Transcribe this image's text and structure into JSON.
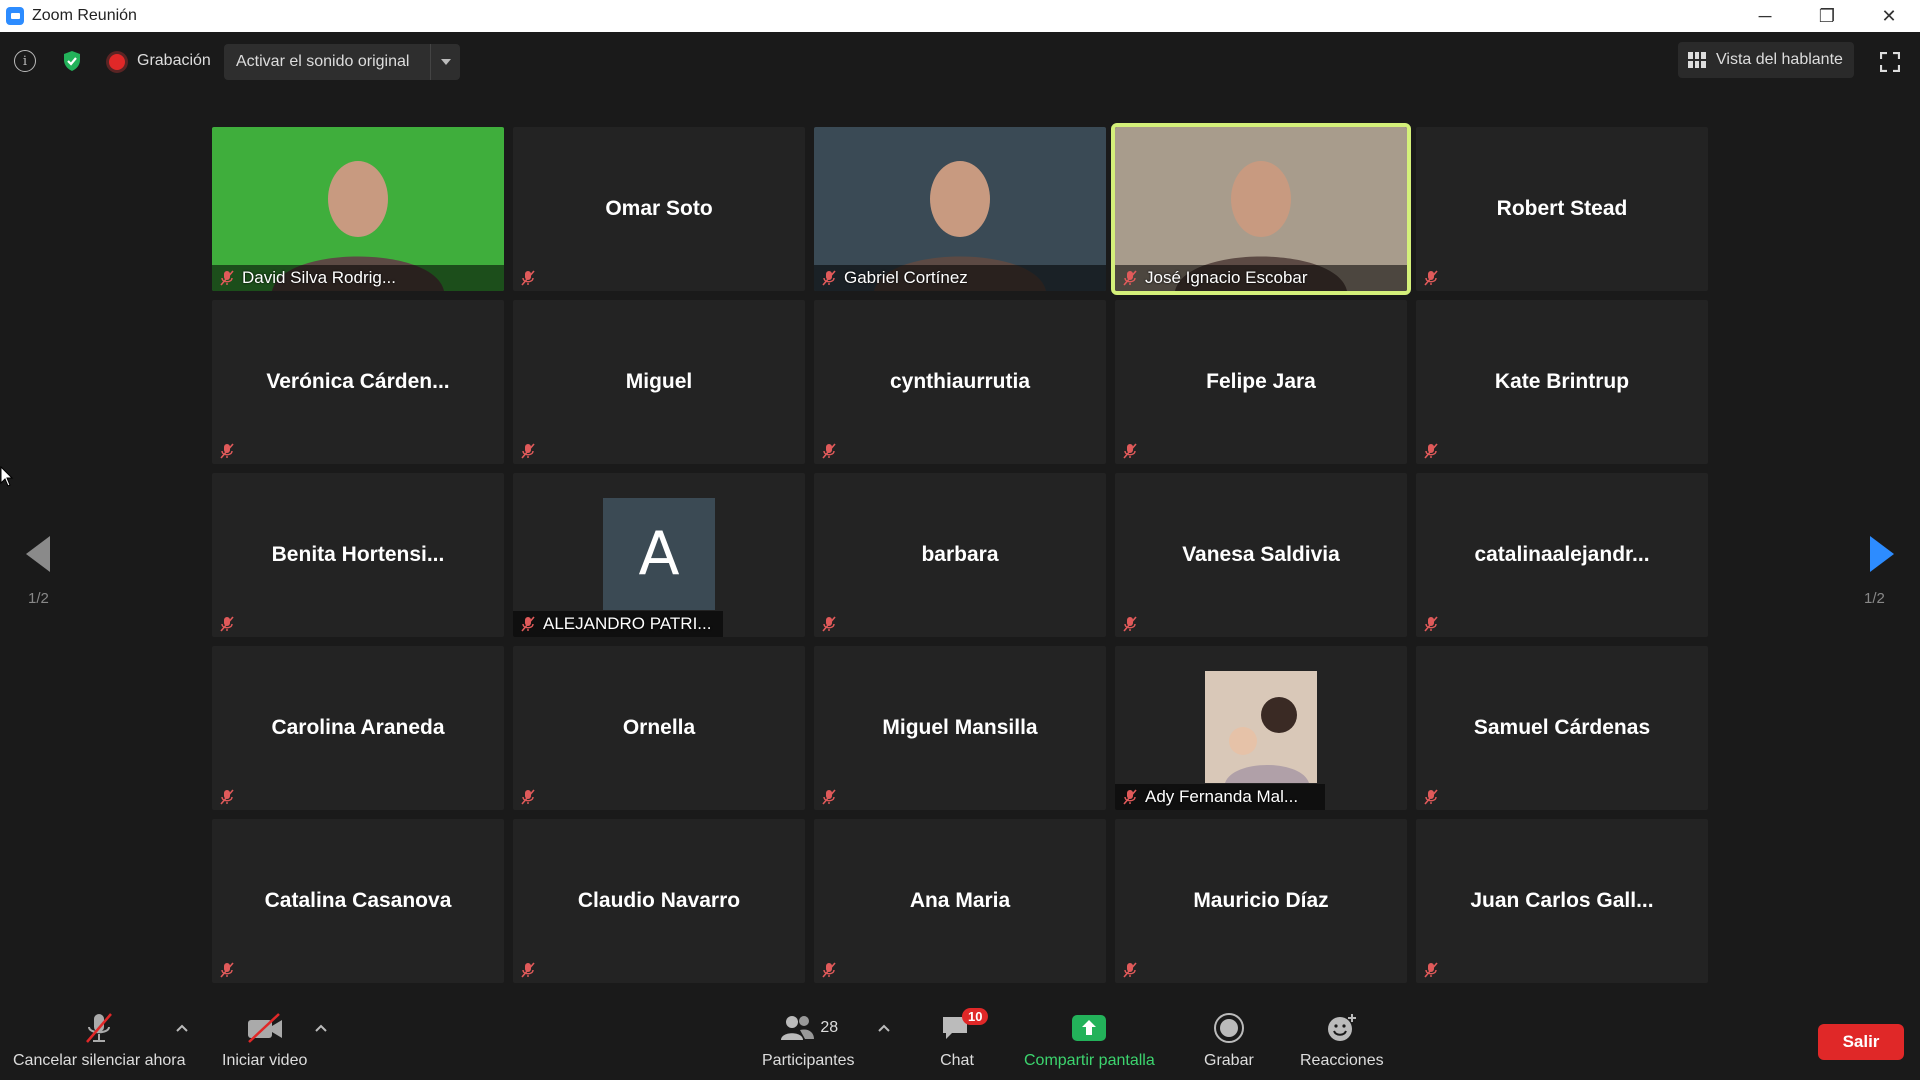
{
  "window": {
    "title": "Zoom Reunión",
    "controls": {
      "minimize": "─",
      "restore": "❐",
      "close": "✕"
    }
  },
  "topbar": {
    "recording_label": "Grabación",
    "original_sound_label": "Activar el sonido original",
    "speaker_view_label": "Vista del hablante"
  },
  "grid": {
    "tiles": [
      {
        "name": "David Silva Rodrig...",
        "video": true,
        "label_position": "bottom",
        "bg": "#3fae3c"
      },
      {
        "name": "Omar Soto",
        "video": false
      },
      {
        "name": "Gabriel Cortínez",
        "video": true,
        "label_position": "bottom",
        "bg": "#3a4a55"
      },
      {
        "name": "José Ignacio Escobar",
        "video": true,
        "label_position": "bottom",
        "bg": "#a89c8c",
        "active": true
      },
      {
        "name": "Robert Stead",
        "video": false
      },
      {
        "name": "Verónica  Cárden...",
        "video": false
      },
      {
        "name": "Miguel",
        "video": false
      },
      {
        "name": "cynthiaurrutia",
        "video": false
      },
      {
        "name": "Felipe Jara",
        "video": false
      },
      {
        "name": "Kate Brintrup",
        "video": false
      },
      {
        "name": "Benita  Hortensi...",
        "video": false
      },
      {
        "name": "ALEJANDRO PATRI...",
        "video": false,
        "avatar_letter": "A",
        "label_position": "bottom"
      },
      {
        "name": "barbara",
        "video": false
      },
      {
        "name": "Vanesa Saldivia",
        "video": false
      },
      {
        "name": "catalinaalejandr...",
        "video": false
      },
      {
        "name": "Carolina Araneda",
        "video": false
      },
      {
        "name": "Ornella",
        "video": false
      },
      {
        "name": "Miguel Mansilla",
        "video": false
      },
      {
        "name": "Ady Fernanda Mal...",
        "video": false,
        "avatar_photo": true,
        "label_position": "bottom"
      },
      {
        "name": "Samuel Cárdenas",
        "video": false
      },
      {
        "name": "Catalina Casanova",
        "video": false
      },
      {
        "name": "Claudio Navarro",
        "video": false
      },
      {
        "name": "Ana Maria",
        "video": false
      },
      {
        "name": "Mauricio Díaz",
        "video": false
      },
      {
        "name": "Juan Carlos  Gall...",
        "video": false
      }
    ]
  },
  "pagination": {
    "left": "1/2",
    "right": "1/2"
  },
  "toolbar": {
    "unmute_label": "Cancelar silenciar ahora",
    "video_label": "Iniciar video",
    "participants_label": "Participantes",
    "participants_count": "28",
    "chat_label": "Chat",
    "chat_badge": "10",
    "share_label": "Compartir pantalla",
    "record_label": "Grabar",
    "reactions_label": "Reacciones",
    "leave_label": "Salir"
  },
  "colors": {
    "accent_blue": "#2d8cff",
    "share_green": "#3cd46e",
    "leave_red": "#e02828",
    "active_speaker": "#d4f07a",
    "mute_red": "#e05a5a"
  }
}
